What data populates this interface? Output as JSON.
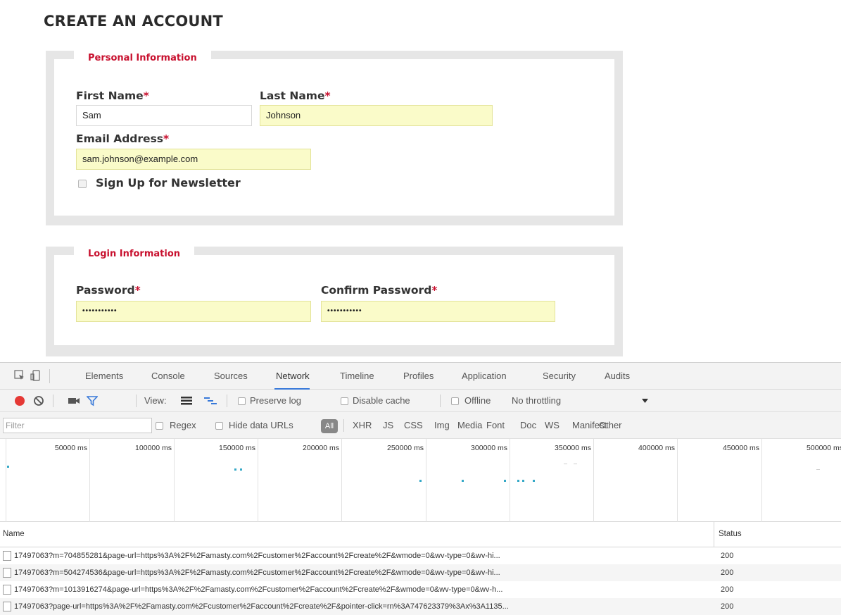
{
  "page": {
    "title": "CREATE AN ACCOUNT"
  },
  "personal": {
    "legend": "Personal Information",
    "first_name_label": "First Name",
    "first_name_value": "Sam",
    "last_name_label": "Last Name",
    "last_name_value": "Johnson",
    "email_label": "Email Address",
    "email_value": "sam.johnson@example.com",
    "newsletter_label": "Sign Up for Newsletter",
    "required_mark": "*"
  },
  "login": {
    "legend": "Login Information",
    "password_label": "Password",
    "password_value": "•••••••••••",
    "confirm_label": "Confirm Password",
    "confirm_value": "•••••••••••"
  },
  "devtools": {
    "tabs": [
      "Elements",
      "Console",
      "Sources",
      "Network",
      "Timeline",
      "Profiles",
      "Application",
      "Security",
      "Audits"
    ],
    "active_tab": "Network",
    "toolbar": {
      "view_label": "View:",
      "preserve_log": "Preserve log",
      "disable_cache": "Disable cache",
      "offline": "Offline",
      "throttling": "No throttling"
    },
    "filterbar": {
      "filter_placeholder": "Filter",
      "regex": "Regex",
      "hide_data_urls": "Hide data URLs",
      "all": "All",
      "types": [
        "XHR",
        "JS",
        "CSS",
        "Img",
        "Media",
        "Font",
        "Doc",
        "WS",
        "Manifest",
        "Other"
      ]
    },
    "timeline_ticks": [
      "50000 ms",
      "100000 ms",
      "150000 ms",
      "200000 ms",
      "250000 ms",
      "300000 ms",
      "350000 ms",
      "400000 ms",
      "450000 ms",
      "500000 ms"
    ],
    "columns": {
      "name": "Name",
      "status": "Status"
    },
    "rows": [
      {
        "name": "17497063?m=704855281&page-url=https%3A%2F%2Famasty.com%2Fcustomer%2Faccount%2Fcreate%2F&wmode=0&wv-type=0&wv-hi...",
        "status": "200"
      },
      {
        "name": "17497063?m=504274536&page-url=https%3A%2F%2Famasty.com%2Fcustomer%2Faccount%2Fcreate%2F&wmode=0&wv-type=0&wv-hi...",
        "status": "200"
      },
      {
        "name": "17497063?m=1013916274&page-url=https%3A%2F%2Famasty.com%2Fcustomer%2Faccount%2Fcreate%2F&wmode=0&wv-type=0&wv-h...",
        "status": "200"
      },
      {
        "name": "17497063?page-url=https%3A%2F%2Famasty.com%2Fcustomer%2Faccount%2Fcreate%2F&pointer-click=rn%3A747623379%3Ax%3A1135...",
        "status": "200"
      }
    ],
    "colors": {
      "record": "#e53935",
      "filter_active": "#3879d9",
      "tab_underline": "#3879d9"
    }
  }
}
